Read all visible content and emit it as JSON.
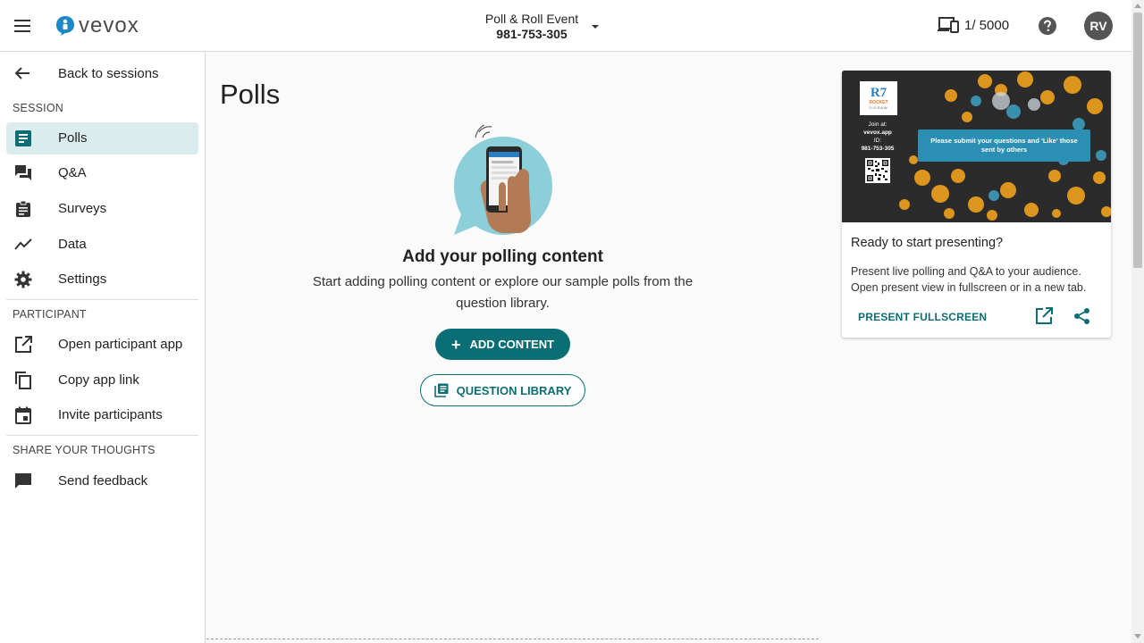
{
  "header": {
    "logo_text": "vevox",
    "event_name": "Poll & Roll Event",
    "event_id": "981-753-305",
    "device_count": "1/ 5000",
    "avatar_initials": "RV"
  },
  "sidebar": {
    "back_label": "Back to sessions",
    "sections": {
      "session": "SESSION",
      "participant": "PARTICIPANT",
      "share": "SHARE YOUR THOUGHTS"
    },
    "session_items": [
      {
        "label": "Polls",
        "icon": "polls-icon",
        "active": true
      },
      {
        "label": "Q&A",
        "icon": "qa-icon"
      },
      {
        "label": "Surveys",
        "icon": "surveys-icon"
      },
      {
        "label": "Data",
        "icon": "data-icon"
      },
      {
        "label": "Settings",
        "icon": "gear-icon"
      }
    ],
    "participant_items": [
      {
        "label": "Open participant app",
        "icon": "open-external-icon"
      },
      {
        "label": "Copy app link",
        "icon": "copy-icon"
      },
      {
        "label": "Invite participants",
        "icon": "calendar-icon"
      }
    ],
    "share_items": [
      {
        "label": "Send feedback",
        "icon": "feedback-icon"
      }
    ]
  },
  "main": {
    "title": "Polls",
    "empty_title": "Add your polling content",
    "empty_desc": "Start adding polling content or explore our sample polls from the question library.",
    "add_content_label": "ADD CONTENT",
    "question_library_label": "QUESTION LIBRARY"
  },
  "present_card": {
    "preview": {
      "logo_text": "R7",
      "logo_subtext": "ROCKET",
      "logo_subtext2": "JIGSAW",
      "join_line1": "Join at:",
      "join_line2": "vevox.app",
      "join_line3": "ID:",
      "join_line4": "981-753-305",
      "banner_text": "Please submit your questions and 'Like' those sent by others"
    },
    "title": "Ready to start presenting?",
    "description": "Present live polling and Q&A to your audience. Open present view in fullscreen or in a new tab.",
    "present_fullscreen_label": "PRESENT FULLSCREEN"
  },
  "colors": {
    "accent": "#0b6e74",
    "active_bg": "#dbecee",
    "banner": "#2a8fb3",
    "illustration": "#8ccfd8"
  }
}
